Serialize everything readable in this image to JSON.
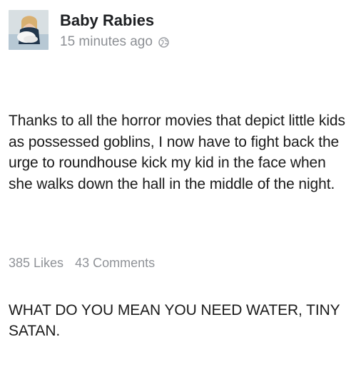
{
  "post": {
    "author": "Baby Rabies",
    "timestamp": "15 minutes ago",
    "privacy_icon": "globe-icon",
    "paragraph_1": "Thanks to all the horror movies that depict little kids as possessed goblins, I now have to fight back the urge to roundhouse kick my kid in the face when she walks down the hall in the middle of the night.",
    "paragraph_2": "WHAT DO YOU MEAN YOU NEED WATER, TINY SATAN.",
    "likes": "385 Likes",
    "comments": "43 Comments"
  },
  "colors": {
    "text": "#1a1a1a",
    "meta": "#8c8f94"
  }
}
